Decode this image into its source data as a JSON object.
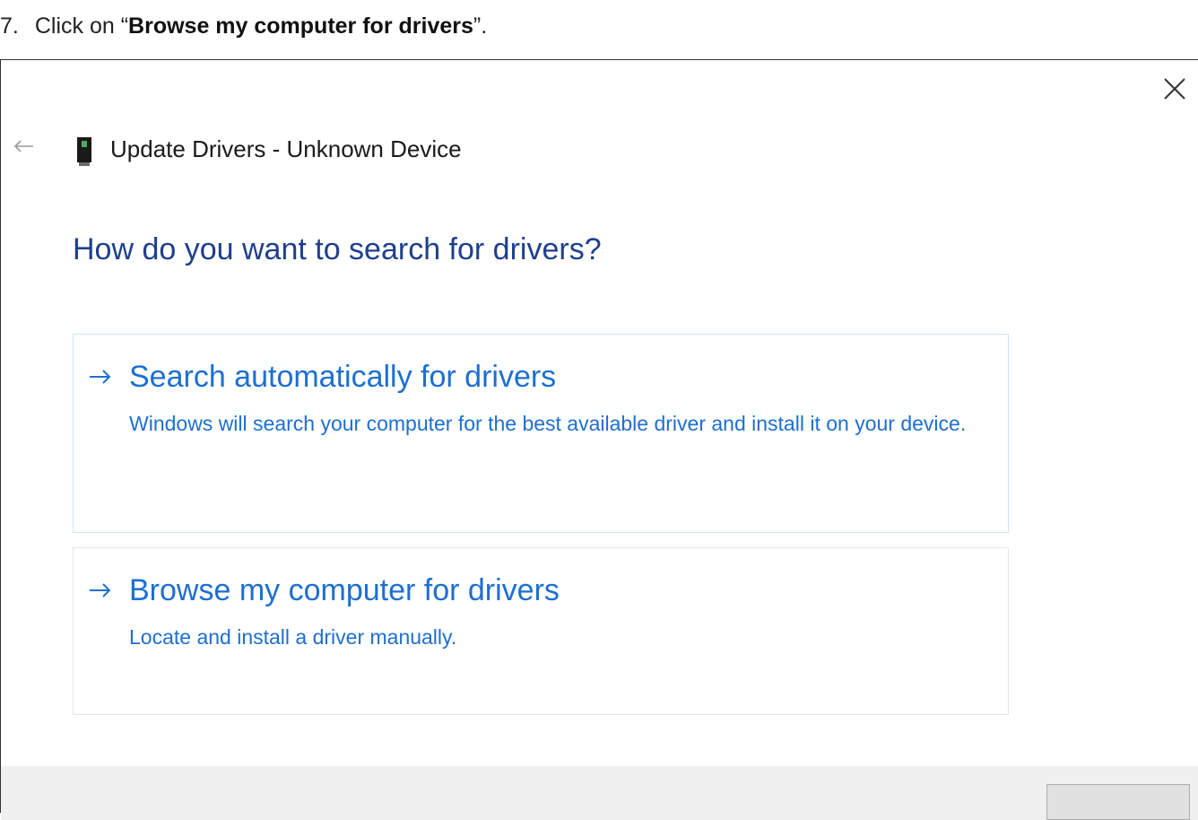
{
  "instruction": {
    "step_number": "7.",
    "prefix": "Click on “",
    "bold_text": "Browse my computer for drivers",
    "suffix": "”."
  },
  "dialog": {
    "title": "Update Drivers - Unknown Device",
    "question": "How do you want to search for drivers?",
    "options": [
      {
        "title": "Search automatically for drivers",
        "description": "Windows will search your computer for the best available driver and install it on your device.",
        "icon": "arrow-right-icon"
      },
      {
        "title": "Browse my computer for drivers",
        "description": "Locate and install a driver manually.",
        "icon": "arrow-right-icon"
      }
    ],
    "icons": {
      "close": "close-icon",
      "back": "back-arrow-icon",
      "device": "device-icon"
    }
  },
  "colors": {
    "question_text": "#1e3f8e",
    "link_text": "#1d6fd1",
    "footer_bg": "#f0f0f0"
  }
}
